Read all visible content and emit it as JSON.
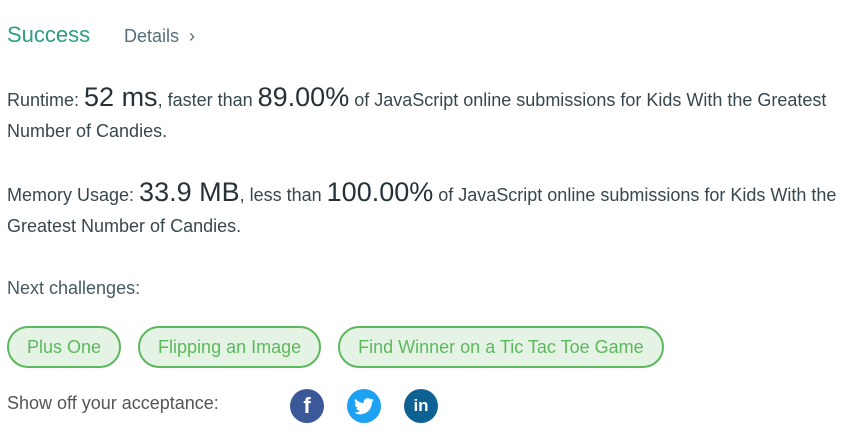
{
  "header": {
    "status": "Success",
    "details_label": "Details",
    "details_chevron": "›"
  },
  "runtime": {
    "label": "Runtime: ",
    "value": "52 ms",
    "mid": ", faster than ",
    "percent": "89.00%",
    "tail": " of JavaScript online submissions for Kids With the Greatest Number of Candies."
  },
  "memory": {
    "label": "Memory Usage: ",
    "value": "33.9 MB",
    "mid": ", less than ",
    "percent": "100.00%",
    "tail": " of JavaScript online submissions for Kids With the Greatest Number of Candies."
  },
  "next": {
    "label": "Next challenges:",
    "items": [
      "Plus One",
      "Flipping an Image",
      "Find Winner on a Tic Tac Toe Game"
    ]
  },
  "share": {
    "label": "Show off your acceptance:",
    "icons": [
      {
        "name": "facebook-icon",
        "glyph": "f",
        "color": "#3b5998"
      },
      {
        "name": "twitter-icon",
        "color": "#1da1f2"
      },
      {
        "name": "linkedin-icon",
        "glyph": "in",
        "color": "#0e6193"
      }
    ]
  },
  "colors": {
    "success": "#2e9d87",
    "tag_border": "#5cb85c",
    "tag_bg": "#e5f3e5"
  }
}
